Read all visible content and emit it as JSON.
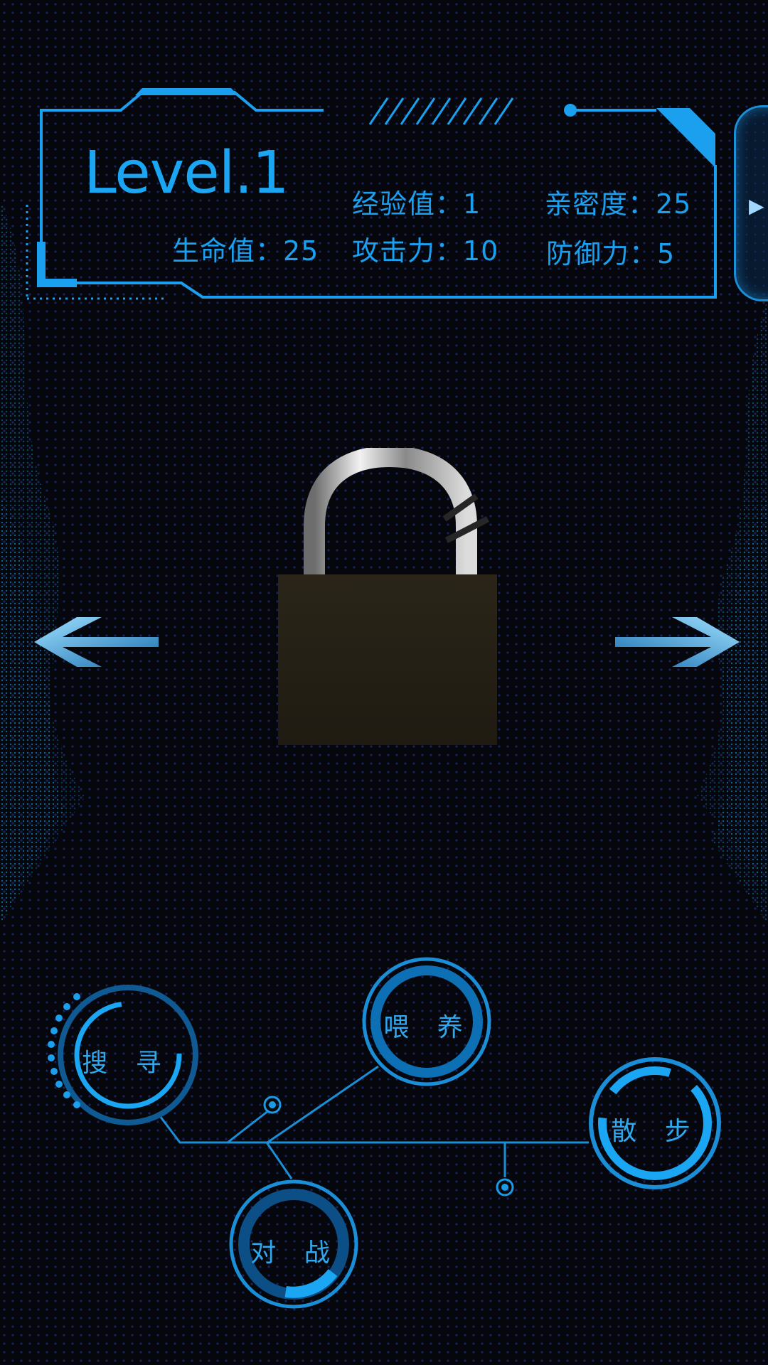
{
  "pet": {
    "level": "Level.1",
    "stats": {
      "exp_label": "经验值：1",
      "intimacy_label": "亲密度：25",
      "hp_label": "生命值：25",
      "attack_label": "攻击力：10",
      "defense_label": "防御力：5"
    }
  },
  "actions": {
    "search": "搜 寻",
    "feed": "喂 养",
    "walk": "散 步",
    "battle": "对 战"
  },
  "icons": {
    "side_tab": "play-triangle-icon",
    "prev": "left-arrow-icon",
    "next": "right-arrow-icon",
    "pet": "padlock-icon"
  },
  "colors": {
    "accent": "#1aa0ee",
    "background": "#05070d"
  }
}
